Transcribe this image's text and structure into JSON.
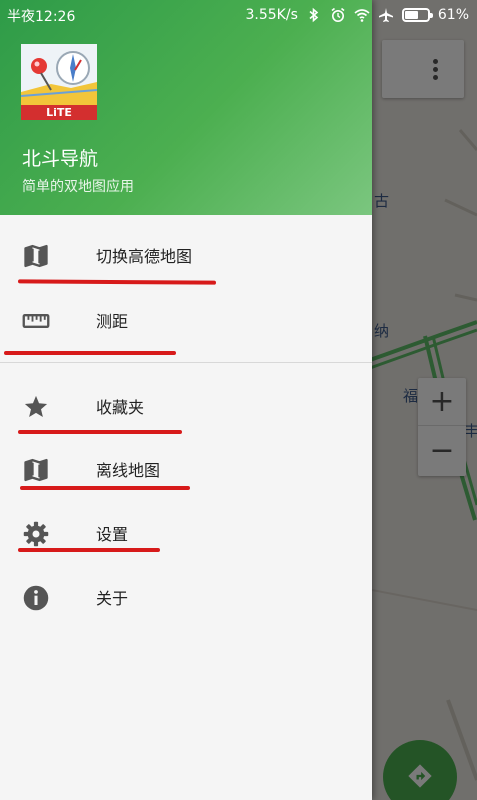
{
  "status_bar": {
    "time": "半夜12:26",
    "network_speed": "3.55K/s",
    "battery": "61%",
    "battery_level": 0.61
  },
  "drawer": {
    "header": {
      "logo_badge": "LiTE",
      "title": "北斗导航",
      "subtitle": "简单的双地图应用"
    },
    "items": [
      {
        "label": "切换高德地图",
        "icon": "map-icon"
      },
      {
        "label": "测距",
        "icon": "ruler-icon"
      },
      {
        "label": "收藏夹",
        "icon": "star-icon"
      },
      {
        "label": "离线地图",
        "icon": "map-icon"
      },
      {
        "label": "设置",
        "icon": "gear-icon"
      },
      {
        "label": "关于",
        "icon": "info-icon"
      }
    ]
  },
  "map": {
    "labels": [
      "古",
      "纳",
      "福",
      "丰"
    ],
    "zoom_in": "+",
    "zoom_out": "−"
  },
  "colors": {
    "header_green": "#4caf50",
    "annotation_red": "#d71a1a",
    "road_green": "#4caf50"
  }
}
